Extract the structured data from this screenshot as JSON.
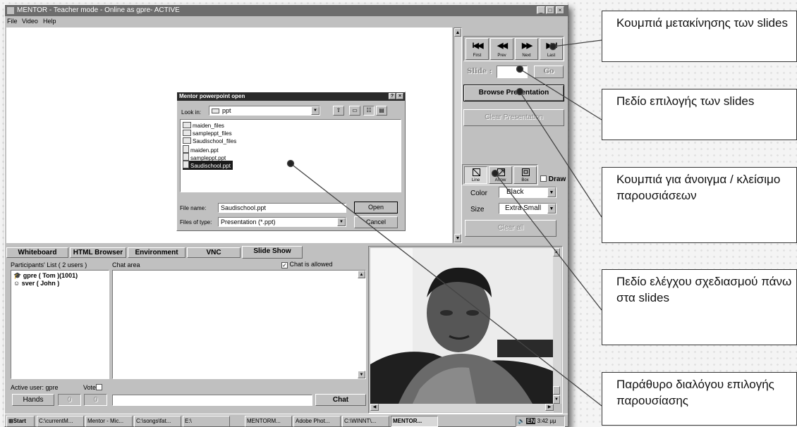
{
  "window": {
    "title": "MENTOR  - Teacher mode - Online as gpre- ACTIVE",
    "menu": [
      "File",
      "Video",
      "Help"
    ]
  },
  "nav": {
    "buttons": [
      {
        "glyph": "I◀◀",
        "label": "First",
        "icon": "first-icon"
      },
      {
        "glyph": "◀◀",
        "label": "Prev",
        "icon": "prev-icon"
      },
      {
        "glyph": "▶▶",
        "label": "Next",
        "icon": "next-icon"
      },
      {
        "glyph": "▶▶I",
        "label": "Last",
        "icon": "last-icon"
      }
    ],
    "slide_label": "Slide :",
    "go_label": "Go",
    "browse_label": "Browse Presentation",
    "clear_label": "Clear Presentation"
  },
  "draw": {
    "tools": [
      {
        "label": "Line",
        "icon": "line-icon"
      },
      {
        "label": "Arrow",
        "icon": "arrow-icon"
      },
      {
        "label": "Box",
        "icon": "box-icon"
      }
    ],
    "draw_label": "Draw",
    "color_label": "Color",
    "color_value": "Black",
    "size_label": "Size",
    "size_value": "Extra Small",
    "clear_all_label": "Clear all"
  },
  "dialog": {
    "title": "Mentor powerpoint open",
    "look_in_label": "Look in:",
    "look_in_value": "ppt",
    "files": [
      "maiden_files",
      "sampleppt_files",
      "Saudischool_files",
      "maiden.ppt",
      "sampleppt.ppt",
      "Saudischool.ppt"
    ],
    "selected_index": 5,
    "file_name_label": "File name:",
    "file_name_value": "Saudischool.ppt",
    "file_type_label": "Files of type:",
    "file_type_value": "Presentation (*.ppt)",
    "open_label": "Open",
    "cancel_label": "Cancel"
  },
  "tabs": [
    "Whiteboard",
    "HTML Browser",
    "Environment",
    "VNC",
    "Slide Show"
  ],
  "active_tab_index": 4,
  "participants": {
    "header": "Participants' List ( 2 users )",
    "users": [
      "gpre ( Tom )(1001)",
      "sver ( John )"
    ]
  },
  "chat": {
    "area_label": "Chat area",
    "allowed_label": "Chat is allowed",
    "send_label": "Chat",
    "input_value": ""
  },
  "active_user": {
    "label": "Active user: gpre",
    "vote_label": "Vote",
    "hands_label": "Hands",
    "count_a": "0",
    "count_b": "0"
  },
  "taskbar": {
    "start_label": "Start",
    "items": [
      "C:\\currentM...",
      "Mentor - Mic...",
      "C:\\songs\\fat...",
      "E:\\",
      "MENTORM...",
      "Adobe Phot...",
      "C:\\WINNT\\...",
      "MENTOR..."
    ],
    "tray_lang": "EN",
    "clock": "3:42 μμ"
  },
  "callouts": [
    "Κουμπιά μετακίνησης των slides",
    "Πεδίο επιλογής των slides",
    "Κουμπιά για άνοιγμα / κλείσιμο παρουσιάσεων",
    "Πεδίο ελέγχου σχεδιασμού πάνω στα slides",
    "Παράθυρο διαλόγου επιλογής παρουσίασης"
  ],
  "colors": {
    "titlebar": "#6d6d6d",
    "window": "#c0c0c0",
    "selection": "#1a1a1a"
  }
}
